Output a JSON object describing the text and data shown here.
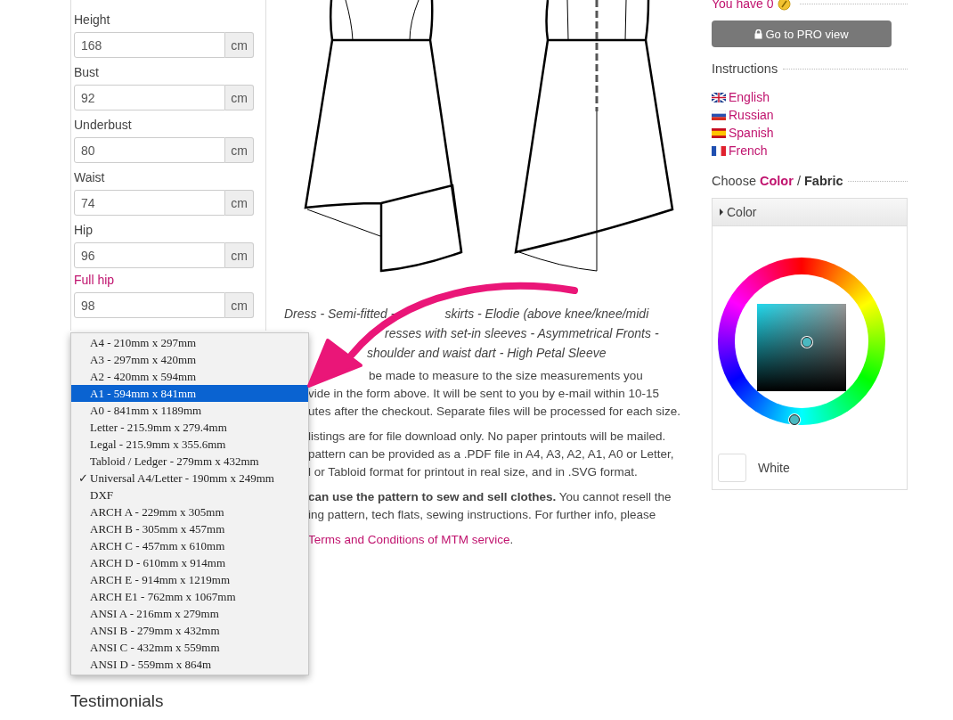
{
  "form": {
    "fields": [
      {
        "label": "Height",
        "value": "168",
        "unit": "cm",
        "highlighted": false
      },
      {
        "label": "Bust",
        "value": "92",
        "unit": "cm",
        "highlighted": false
      },
      {
        "label": "Underbust",
        "value": "80",
        "unit": "cm",
        "highlighted": false
      },
      {
        "label": "Waist",
        "value": "74",
        "unit": "cm",
        "highlighted": false
      },
      {
        "label": "Hip",
        "value": "96",
        "unit": "cm",
        "highlighted": false
      },
      {
        "label": "Full hip",
        "value": "98",
        "unit": "cm",
        "highlighted": true
      }
    ]
  },
  "size_dropdown": {
    "check_glyph": "✓",
    "options": [
      {
        "label": "A4 - 210mm x 297mm",
        "selected": false,
        "checked": false
      },
      {
        "label": "A3 - 297mm x 420mm",
        "selected": false,
        "checked": false
      },
      {
        "label": "A2 - 420mm x 594mm",
        "selected": false,
        "checked": false
      },
      {
        "label": "A1 - 594mm x 841mm",
        "selected": true,
        "checked": false
      },
      {
        "label": "A0 - 841mm x 1189mm",
        "selected": false,
        "checked": false
      },
      {
        "label": "Letter - 215.9mm x 279.4mm",
        "selected": false,
        "checked": false
      },
      {
        "label": "Legal - 215.9mm x 355.6mm",
        "selected": false,
        "checked": false
      },
      {
        "label": "Tabloid / Ledger - 279mm x 432mm",
        "selected": false,
        "checked": false
      },
      {
        "label": "Universal A4/Letter - 190mm x 249mm",
        "selected": false,
        "checked": true
      },
      {
        "label": "DXF",
        "selected": false,
        "checked": false
      },
      {
        "label": "ARCH A - 229mm x 305mm",
        "selected": false,
        "checked": false
      },
      {
        "label": "ARCH B - 305mm x 457mm",
        "selected": false,
        "checked": false
      },
      {
        "label": "ARCH C - 457mm x 610mm",
        "selected": false,
        "checked": false
      },
      {
        "label": "ARCH D - 610mm x 914mm",
        "selected": false,
        "checked": false
      },
      {
        "label": "ARCH E - 914mm x 1219mm",
        "selected": false,
        "checked": false
      },
      {
        "label": "ARCH E1 - 762mm x 1067mm",
        "selected": false,
        "checked": false
      },
      {
        "label": "ANSI A - 216mm x 279mm",
        "selected": false,
        "checked": false
      },
      {
        "label": "ANSI B - 279mm x 432mm",
        "selected": false,
        "checked": false
      },
      {
        "label": "ANSI C - 432mm x 559mm",
        "selected": false,
        "checked": false
      },
      {
        "label": "ANSI D - 559mm x 864m",
        "selected": false,
        "checked": false
      }
    ]
  },
  "testimonials": {
    "heading": "Testimonials"
  },
  "product": {
    "title_lines": [
      [
        "Dress - Semi-fitted -",
        "skirts - Elodie (above knee/knee/midi"
      ],
      [
        "resses with set-in sleeves - Asymmetrical Fronts -"
      ],
      [
        "shoulder and waist dart - High Petal Sleeve"
      ]
    ],
    "paragraphs": [
      [
        "be made to measure to the size measurements you",
        "vide in the form above. It will be sent to you by e-mail within 10-15",
        "utes after the checkout. Separate files will be processed for each size."
      ],
      [
        "listings are for file download only. No paper printouts will be mailed.",
        "pattern can be provided as a .PDF file in A4, A3, A2, A1, A0 or Letter,",
        "l or Tabloid format for printout in real size, and in .SVG format."
      ],
      [
        "**can use the pattern to sew and sell clothes.** You cannot resell the",
        "ing pattern, tech flats, sewing instructions. For further info, please"
      ]
    ],
    "link": "Terms and Conditions of MTM service",
    "link_after": "."
  },
  "sidebar": {
    "credits": "You have 0",
    "pro_button": "Go to PRO view",
    "instructions_heading": "Instructions",
    "languages": [
      {
        "label": "English",
        "kind": "uk"
      },
      {
        "label": "Russian",
        "kind": "ru"
      },
      {
        "label": "Spanish",
        "kind": "es"
      },
      {
        "label": "French",
        "kind": "fr"
      }
    ],
    "color_heading": "Choose **Color** / **Fabric**",
    "color_panel": {
      "header": "Color",
      "swatch_label": "White"
    }
  }
}
